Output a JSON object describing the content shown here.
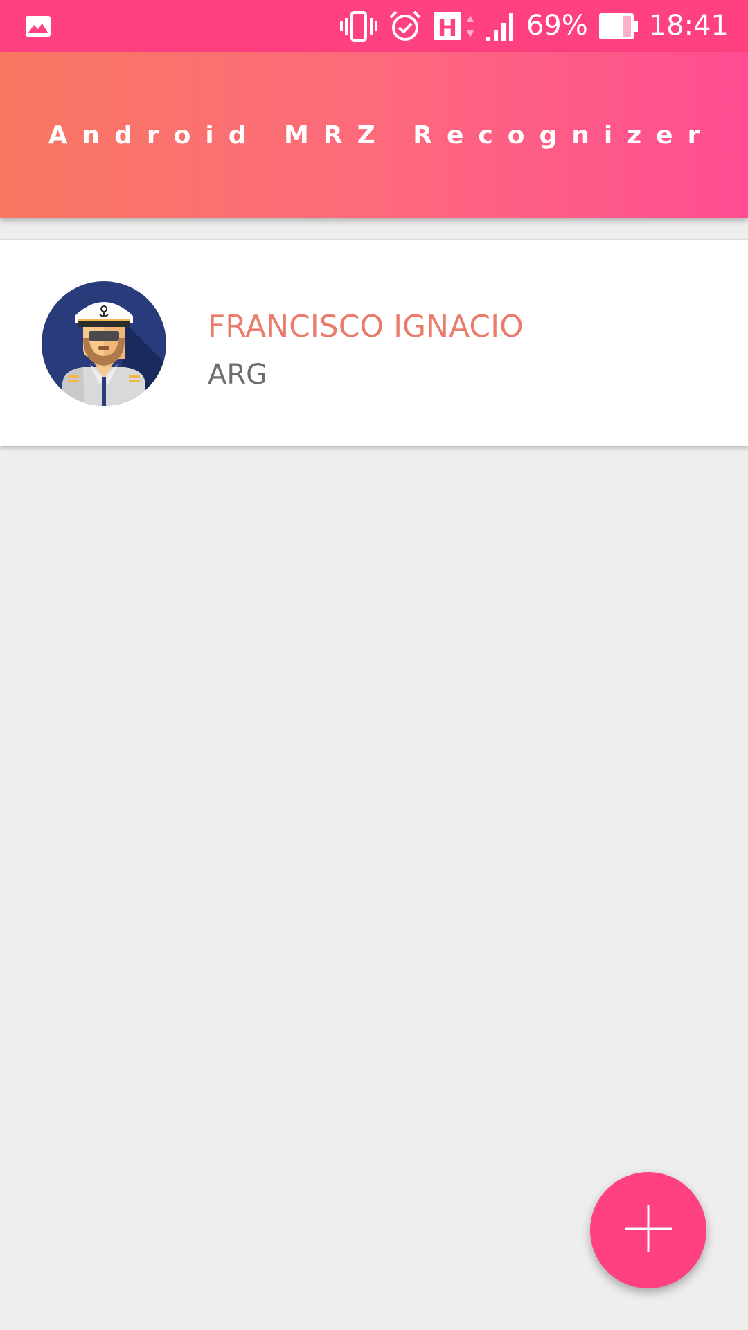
{
  "status_bar": {
    "notification_icon": "image-icon",
    "vibrate_icon": "vibrate-icon",
    "alarm_icon": "alarm-icon",
    "network_type": "H",
    "signal_icon": "signal-icon",
    "battery_percent": "69%",
    "battery_icon": "battery-icon",
    "time": "18:41"
  },
  "app_bar": {
    "title": "Android MRZ Recognizer"
  },
  "list": {
    "items": [
      {
        "avatar_icon": "captain-avatar-icon",
        "name": "FRANCISCO IGNACIO",
        "country": "ARG"
      }
    ]
  },
  "fab": {
    "icon": "plus-icon"
  },
  "colors": {
    "status_bar": "#ff4081",
    "app_bar_gradient_start": "#f87862",
    "app_bar_gradient_end": "#ff4d92",
    "name_text": "#ea7c6c",
    "country_text": "#6e6e6e",
    "fab": "#ff4081",
    "background": "#eeeeee"
  }
}
